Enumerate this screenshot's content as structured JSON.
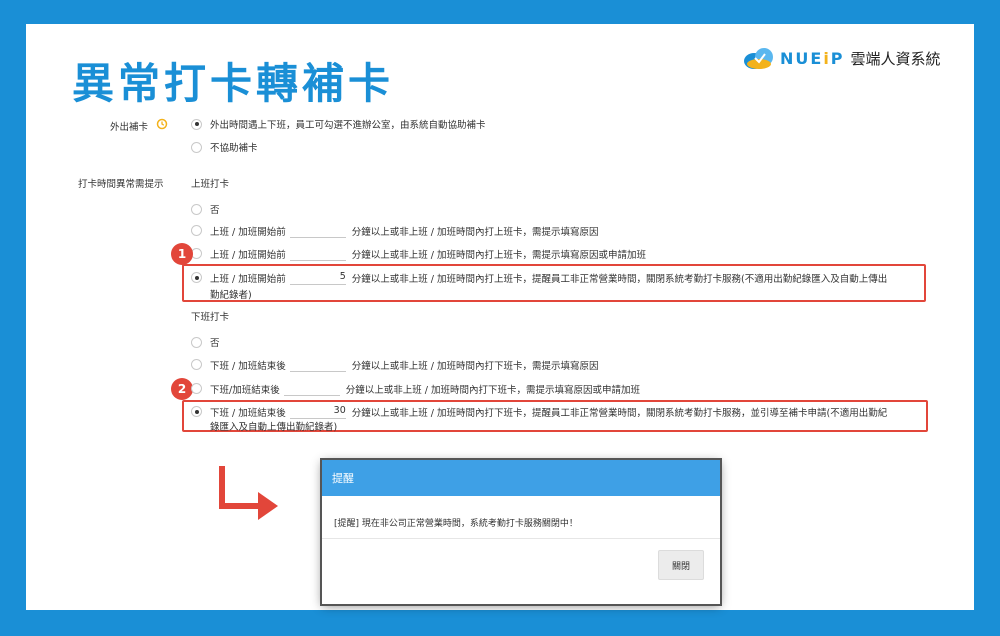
{
  "title": "異常打卡轉補卡",
  "logo": {
    "brand_a": "NUE",
    "brand_e": "i",
    "brand_b": "P",
    "tagline": "雲端人資系統"
  },
  "outing": {
    "label": "外出補卡",
    "option_on": "外出時間遇上下班，員工可勾選不進辦公室，由系統自動協助補卡",
    "option_off": "不協助補卡"
  },
  "abnormal": {
    "label": "打卡時間異常需提示",
    "clock_in": {
      "heading": "上班打卡",
      "no": "否",
      "opt1_prefix": "上班 / 加班開始前",
      "opt1_suffix": "分鐘以上或非上班 / 加班時間內打上班卡，需提示填寫原因",
      "opt2_prefix": "上班 / 加班開始前",
      "opt2_suffix": "分鐘以上或非上班 / 加班時間內打上班卡，需提示填寫原因或申請加班",
      "opt3_prefix": "上班 / 加班開始前",
      "opt3_value": "5",
      "opt3_suffix": "分鐘以上或非上班 / 加班時間內打上班卡，提醒員工非正常營業時間，關閉系統考勤打卡服務(不適用出勤紀錄匯入及自動上傳出",
      "opt3_wrap": "勤紀錄者)"
    },
    "clock_out": {
      "heading": "下班打卡",
      "no": "否",
      "opt1_prefix": "下班 / 加班結束後",
      "opt1_suffix": "分鐘以上或非上班 / 加班時間內打下班卡，需提示填寫原因",
      "opt2_prefix": "下班/加班結束後",
      "opt2_suffix": "分鐘以上或非上班 / 加班時間內打下班卡，需提示填寫原因或申請加班",
      "opt3_prefix": "下班 / 加班結束後",
      "opt3_value": "30",
      "opt3_suffix": "分鐘以上或非上班 / 加班時間內打下班卡，提醒員工非正常營業時間，關閉系統考勤打卡服務，並引導至補卡申請(不適用出勤紀",
      "opt3_wrap": "錄匯入及自動上傳出勤紀錄者)"
    }
  },
  "badges": [
    "1",
    "2"
  ],
  "modal": {
    "title": "提醒",
    "message": "[提醒] 現在非公司正常營業時間，系統考勤打卡服務關閉中！",
    "close": "關閉"
  },
  "colors": {
    "accent": "#1a8fd6",
    "highlight": "#e2463a",
    "modal_header": "#3ea0e6"
  },
  "icons": {
    "outing_hint": "clock-history-icon",
    "arrow": "arrow-down-right-icon"
  }
}
